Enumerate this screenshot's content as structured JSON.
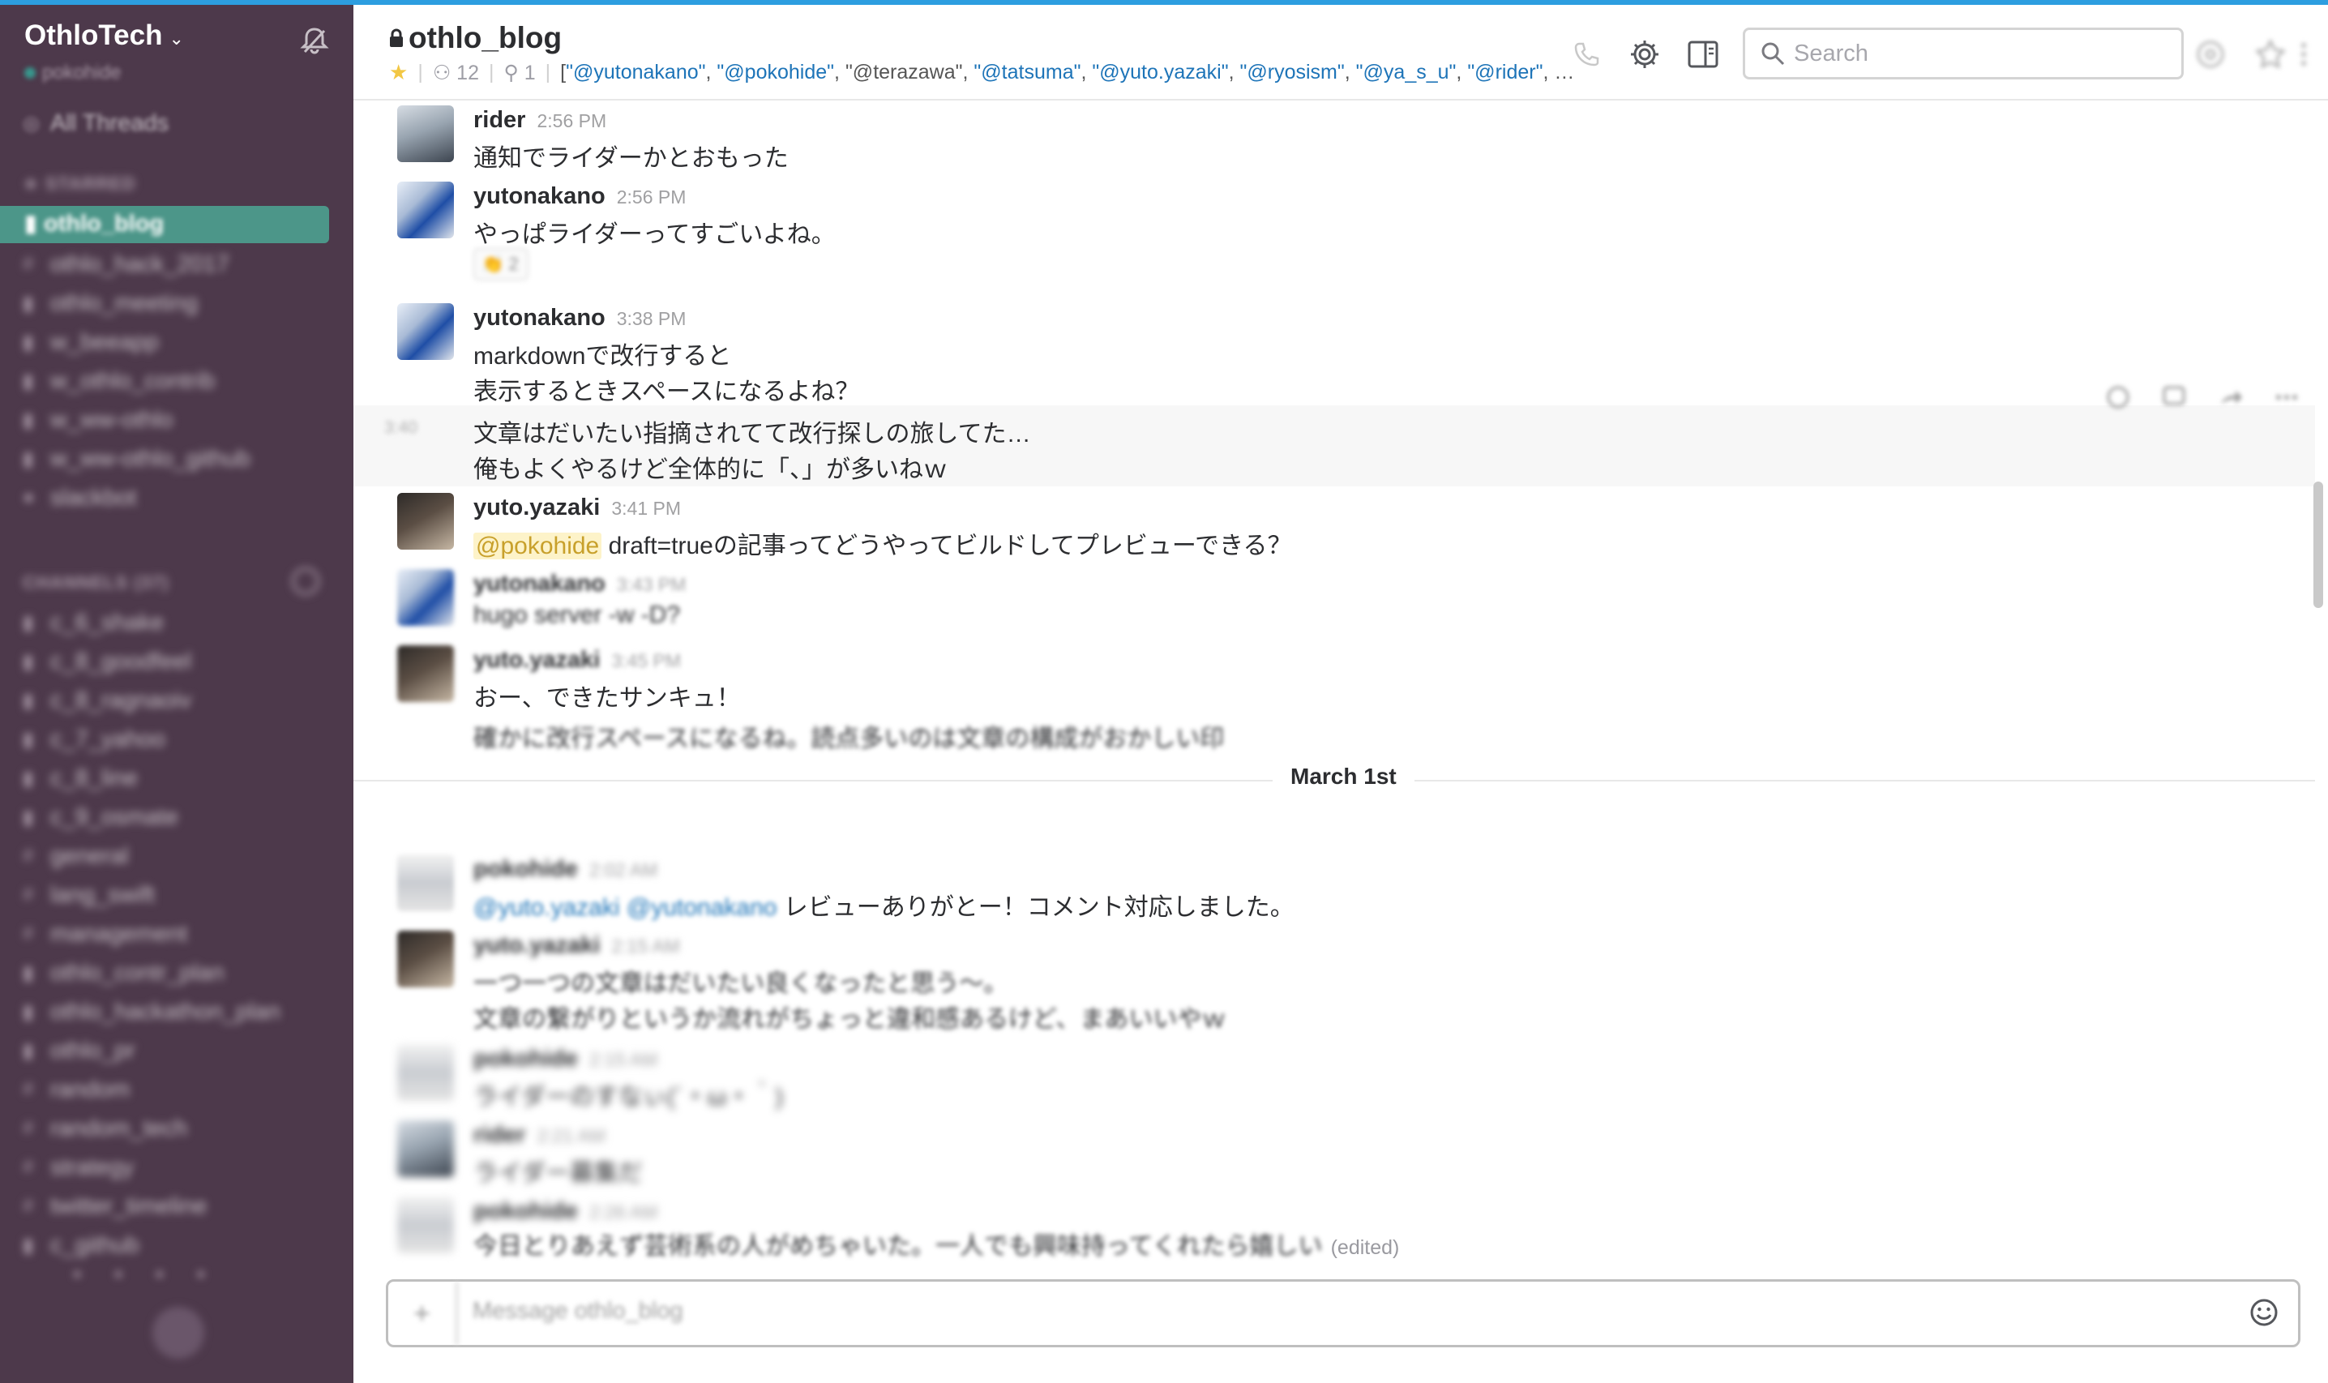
{
  "team": {
    "name": "OthloTech",
    "user": "pokohide"
  },
  "sidebar": {
    "all_threads": "All Threads",
    "starred_header": "STARRED",
    "starred": [
      {
        "label": "othlo_blog",
        "glyph": "lock"
      },
      {
        "label": "othlo_hack_2017",
        "glyph": "hash"
      },
      {
        "label": "othlo_meeting",
        "glyph": "lock"
      },
      {
        "label": "w_beeapp",
        "glyph": "lock"
      },
      {
        "label": "w_othlo_contrib",
        "glyph": "lock"
      },
      {
        "label": "w_ww-othlo",
        "glyph": "lock"
      },
      {
        "label": "w_ww-othlo_github",
        "glyph": "lock"
      },
      {
        "label": "slackbot",
        "glyph": "dot"
      }
    ],
    "channels_header": "CHANNELS (37)",
    "channels": [
      "c_6_shake",
      "c_8_goodfeel",
      "c_8_ragnaoiv",
      "c_7_yahoo",
      "c_8_line",
      "c_9_osmate",
      "general",
      "lang_swift",
      "management",
      "othlo_contr_plan",
      "othlo_hackathon_plan",
      "othlo_pr",
      "random",
      "random_tech",
      "strategy",
      "twitter_timeline",
      "c_github"
    ]
  },
  "header": {
    "channel": "othlo_blog",
    "members": "12",
    "pinned": "1",
    "topic_open": "[",
    "topic_mentions": [
      "\"@yutonakano\"",
      "\"@pokohide\"",
      "\"@terazawa\"",
      "\"@tatsuma\"",
      "\"@yuto.yazaki\"",
      "\"@ryosism\"",
      "\"@ya_s_u\"",
      "\"@rider\""
    ],
    "topic_more": "…",
    "search_placeholder": "Search"
  },
  "messages": [
    {
      "author": "rider",
      "time": "2:56 PM",
      "text": "通知でライダーかとおもった"
    },
    {
      "author": "yutonakano",
      "time": "2:56 PM",
      "text": "やっぱライダーってすごいよね。",
      "reaction_count": "2"
    },
    {
      "author": "yutonakano",
      "time": "3:38 PM",
      "lines": [
        "markdownで改行すると",
        "表示するときスペースになるよね？"
      ]
    },
    {
      "side_time": "3:40",
      "lines": [
        "文章はだいたい指摘されてて改行探しの旅してた…",
        "俺もよくやるけど全体的に「、」が多いねｗ"
      ]
    },
    {
      "author": "yuto.yazaki",
      "time": "3:41 PM",
      "mention": "@pokohide",
      "text": " draft=trueの記事ってどうやってビルドしてプレビューできる？"
    },
    {
      "author": "yutonakano",
      "time": "3:43 PM",
      "text": "hugo server -w -D?"
    },
    {
      "author": "yuto.yazaki",
      "time": "3:45 PM",
      "lines": [
        "おー、できたサンキュ！",
        "確かに改行スペースになるね。読点多いのは文章の構成がおかしい印"
      ]
    }
  ],
  "day_divider": "March 1st",
  "messages_after": [
    {
      "author": "pokohide",
      "time": "2:02 AM",
      "mentions": "@yuto.yazaki @yutonakano",
      "text": " レビューありがとー！コメント対応しました。"
    },
    {
      "author": "yuto.yazaki",
      "time": "2:15 AM",
      "lines": [
        "一つ一つの文章はだいたい良くなったと思う〜。",
        "文章の繋がりというか流れがちょっと違和感あるけど、まあいいやｗ"
      ]
    },
    {
      "author": "pokohide",
      "time": "2:15 AM",
      "text": "ライダーのすなぃ(´・ω・｀)"
    },
    {
      "author": "rider",
      "time": "2:21 AM",
      "text": "ライダー募集だ"
    },
    {
      "author": "pokohide",
      "time": "2:26 AM",
      "text": "今日とりあえず芸術系の人がめちゃいた。一人でも興味持ってくれたら嬉しい",
      "edited": "(edited)"
    }
  ],
  "composer": {
    "placeholder": "Message othlo_blog",
    "plus": "+"
  },
  "icons": [
    "bell-icon",
    "lock-icon",
    "star-icon",
    "member-icon",
    "pin-icon",
    "phone-icon",
    "gear-icon",
    "sidebar-toggle-icon",
    "search-icon",
    "mentions-icon",
    "starred-items-icon",
    "more-icon",
    "add-reaction-icon",
    "comment-icon",
    "share-icon",
    "emoji-icon"
  ],
  "colors": {
    "sidebar_bg": "#4d394b",
    "active_channel": "#4c9689",
    "link": "#1d74b8",
    "mention_highlight": "#fdf3c9",
    "top_bar": "#2d9ee0"
  }
}
